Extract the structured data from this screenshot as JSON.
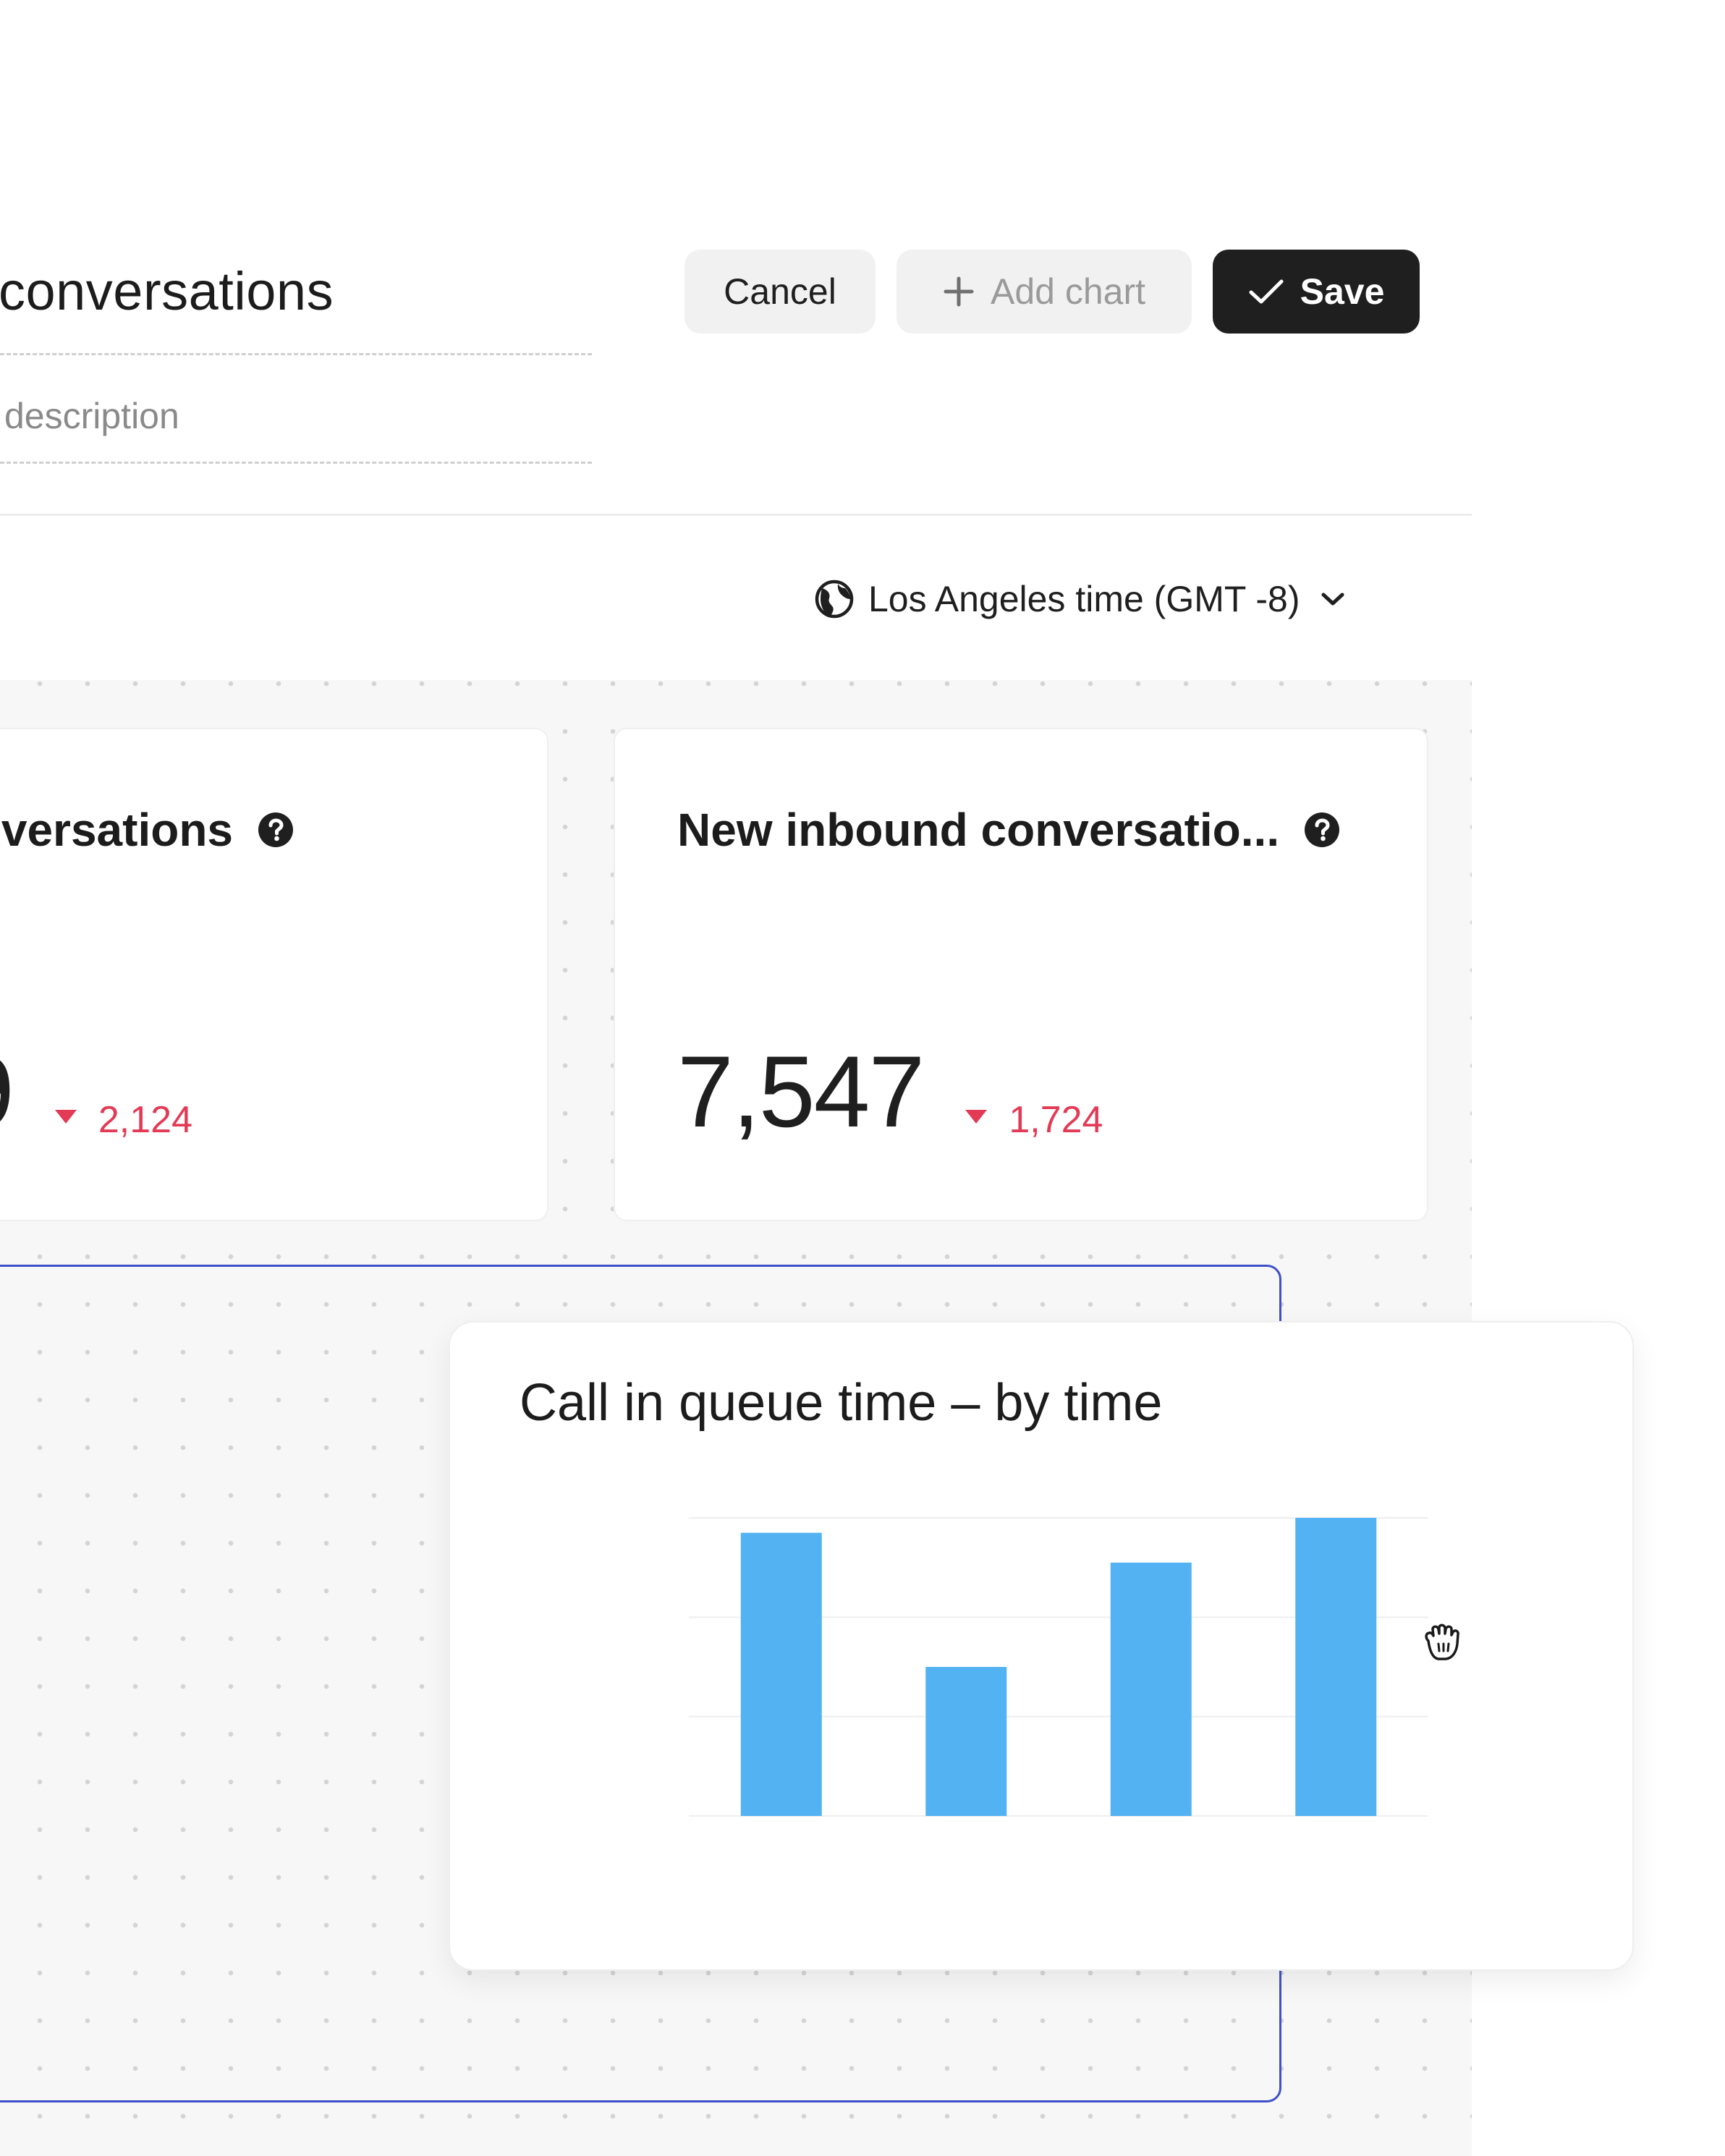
{
  "header": {
    "title": "conversations",
    "description_placeholder": "description",
    "cancel_label": "Cancel",
    "add_chart_label": "Add chart",
    "save_label": "Save"
  },
  "timezone": {
    "label": "Los Angeles time (GMT -8)",
    "icon": "globe-icon"
  },
  "cards": [
    {
      "title": "versations",
      "value": "9",
      "delta": "2,124",
      "delta_direction": "down",
      "help_icon": "question-circle-icon"
    },
    {
      "title": "New inbound conversatio...",
      "value": "7,547",
      "delta": "1,724",
      "delta_direction": "down",
      "help_icon": "question-circle-icon"
    }
  ],
  "chart_card": {
    "title": "Call in queue time – by time"
  },
  "chart_data": {
    "type": "bar",
    "categories": [
      "",
      "",
      "",
      ""
    ],
    "values": [
      95,
      50,
      85,
      100
    ],
    "ylim": [
      0,
      100
    ],
    "grid": true,
    "bar_color": "#52b2f2"
  },
  "colors": {
    "accent_frame": "#3f51c9",
    "negative": "#e33a55",
    "bar": "#52b2f2",
    "primary_button": "#1f1f1f"
  }
}
